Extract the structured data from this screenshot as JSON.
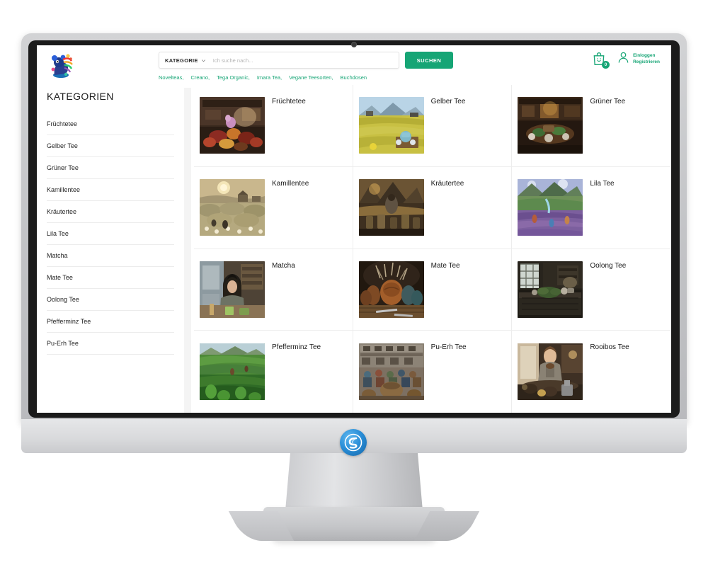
{
  "header": {
    "logo_name": "tea-shop-logo",
    "search": {
      "category_label": "KATEGORIE",
      "placeholder": "Ich suche nach...",
      "value": "",
      "button_label": "SUCHEN"
    },
    "nav_links": [
      "Novelteas,",
      "Creano,",
      "Tega Organic,",
      "Imara Tea,",
      "Vegane Teesorten,",
      "Buchdosen"
    ],
    "cart": {
      "count": "0",
      "icon": "shopping-bag-icon"
    },
    "account": {
      "icon": "user-icon",
      "line1": "Einloggen",
      "line2": "Registrieren"
    }
  },
  "sidebar": {
    "title": "KATEGORIEN",
    "items": [
      {
        "label": "Früchtetee"
      },
      {
        "label": "Gelber Tee"
      },
      {
        "label": "Grüner Tee"
      },
      {
        "label": "Kamillentee"
      },
      {
        "label": "Kräutertee"
      },
      {
        "label": "Lila Tee"
      },
      {
        "label": "Matcha"
      },
      {
        "label": "Mate Tee"
      },
      {
        "label": "Oolong Tee"
      },
      {
        "label": "Pfefferminz Tee"
      },
      {
        "label": "Pu-Erh Tee"
      }
    ]
  },
  "grid": {
    "items": [
      {
        "label": "Früchtetee",
        "image": "fruit-tea-table-photo"
      },
      {
        "label": "Gelber Tee",
        "image": "yellow-tea-field-photo"
      },
      {
        "label": "Grüner Tee",
        "image": "green-tea-room-photo"
      },
      {
        "label": "Kamillentee",
        "image": "chamomile-field-photo"
      },
      {
        "label": "Kräutertee",
        "image": "herbal-mountain-photo"
      },
      {
        "label": "Lila Tee",
        "image": "purple-tea-valley-photo"
      },
      {
        "label": "Matcha",
        "image": "matcha-cafe-photo"
      },
      {
        "label": "Mate Tee",
        "image": "mate-gourds-photo"
      },
      {
        "label": "Oolong Tee",
        "image": "oolong-table-photo"
      },
      {
        "label": "Pfefferminz Tee",
        "image": "peppermint-field-photo"
      },
      {
        "label": "Pu-Erh Tee",
        "image": "puerh-market-photo"
      },
      {
        "label": "Rooibos Tee",
        "image": "rooibos-woman-photo"
      }
    ]
  },
  "device": {
    "brand_badge": "monitor-brand-logo"
  },
  "colors": {
    "accent": "#16a575",
    "text": "#1a1a1a",
    "divider": "#ededed",
    "bezel": "#1b1b1b"
  }
}
